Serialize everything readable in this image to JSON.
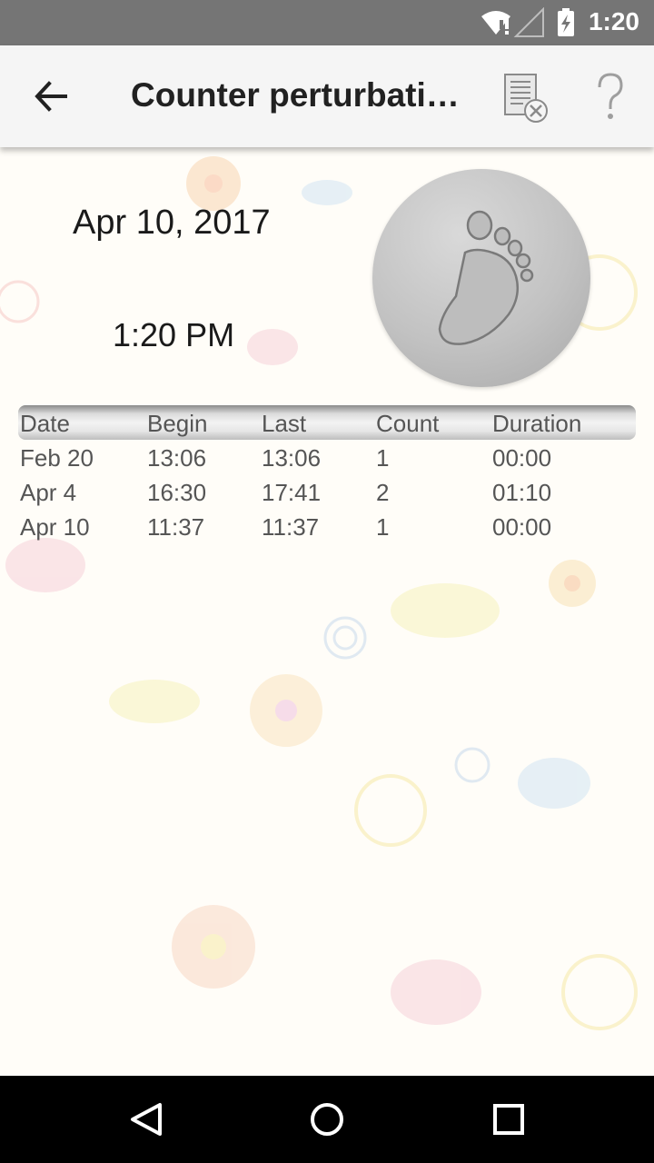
{
  "status_bar": {
    "time": "1:20",
    "icons": [
      "wifi-icon",
      "signal-icon",
      "battery-charging-icon"
    ]
  },
  "app_bar": {
    "title": "Counter perturbati…",
    "back_icon": "arrow-back-icon",
    "actions": [
      "clear-list-icon",
      "help-icon"
    ]
  },
  "main": {
    "date": "Apr 10, 2017",
    "time": "1:20 PM",
    "counter_button_icon": "footprint-icon"
  },
  "table": {
    "headers": [
      "Date",
      "Begin",
      "Last",
      "Count",
      "Duration"
    ],
    "rows": [
      [
        "Feb 20",
        "13:06",
        "13:06",
        "1",
        "00:00"
      ],
      [
        "Apr 4",
        "16:30",
        "17:41",
        "2",
        "01:10"
      ],
      [
        "Apr 10",
        "11:37",
        "11:37",
        "1",
        "00:00"
      ]
    ]
  },
  "nav_bar": {
    "buttons": [
      "back-triangle-icon",
      "home-circle-icon",
      "recents-square-icon"
    ]
  },
  "colors": {
    "status_bar": "#757575",
    "app_bar": "#f5f5f5",
    "nav_bar": "#000000",
    "table_text": "#555555"
  }
}
